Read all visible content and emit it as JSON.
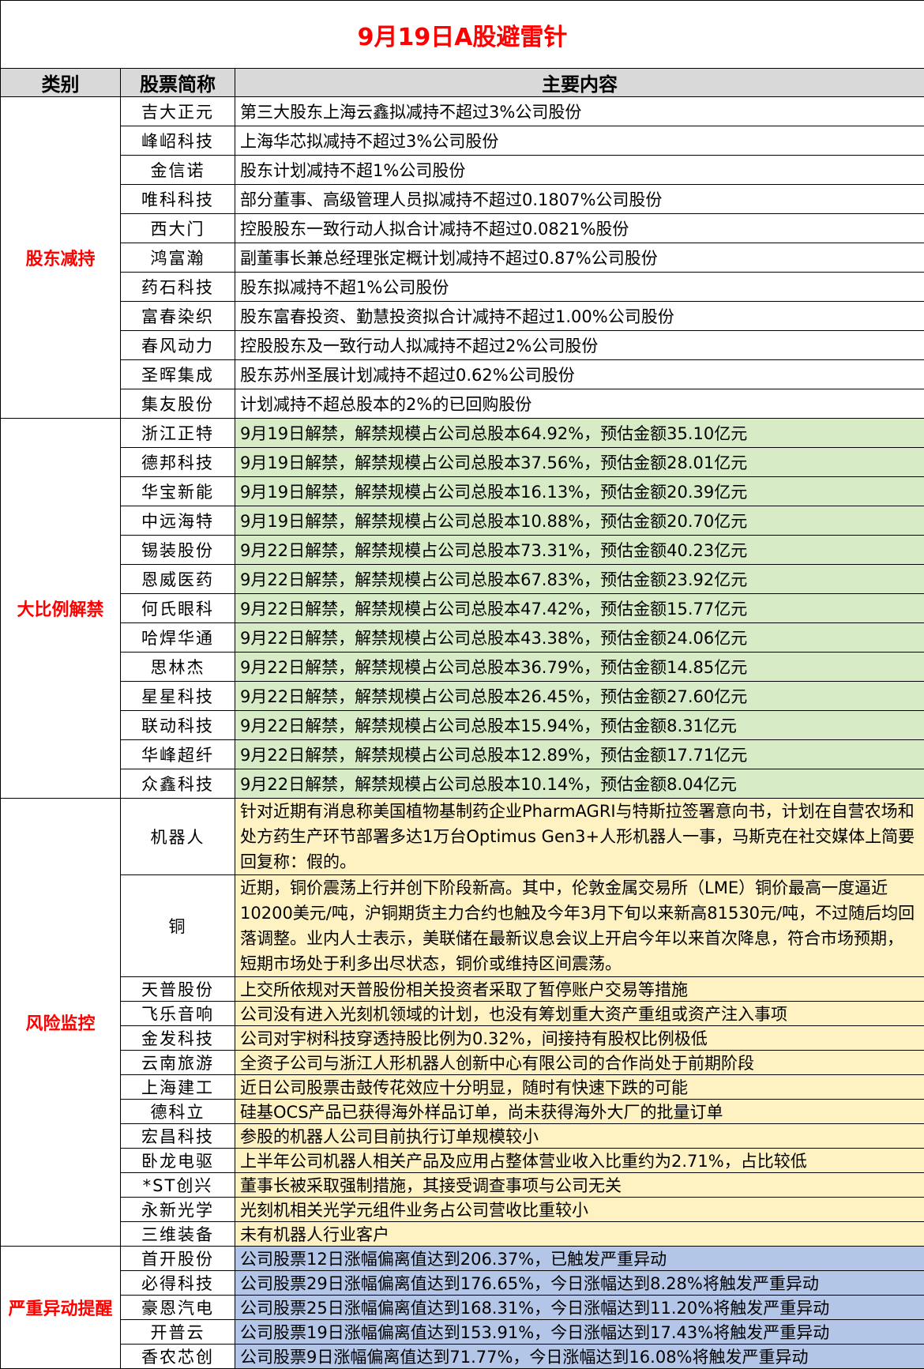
{
  "title": "9月19日A股避雷针",
  "headers": {
    "category": "类别",
    "stock": "股票简称",
    "content": "主要内容"
  },
  "sections": [
    {
      "category": "股东减持",
      "rows": [
        {
          "stock": "吉大正元",
          "content": "第三大股东上海云鑫拟减持不超过3%公司股份"
        },
        {
          "stock": "峰岹科技",
          "content": "上海华芯拟减持不超过3%公司股份"
        },
        {
          "stock": "金信诺",
          "content": "股东计划减持不超1%公司股份"
        },
        {
          "stock": "唯科科技",
          "content": "部分董事、高级管理人员拟减持不超过0.1807%公司股份"
        },
        {
          "stock": "西大门",
          "content": "控股股东一致行动人拟合计减持不超过0.0821%股份"
        },
        {
          "stock": "鸿富瀚",
          "content": "副董事长兼总经理张定概计划减持不超过0.87%公司股份"
        },
        {
          "stock": "药石科技",
          "content": "股东拟减持不超1%公司股份"
        },
        {
          "stock": "富春染织",
          "content": "股东富春投资、勤慧投资拟合计减持不超过1.00%公司股份"
        },
        {
          "stock": "春风动力",
          "content": "控股股东及一致行动人拟减持不超过2%公司股份"
        },
        {
          "stock": "圣晖集成",
          "content": "股东苏州圣展计划减持不超过0.62%公司股份"
        },
        {
          "stock": "集友股份",
          "content": "计划减持不超总股本的2%的已回购股份"
        }
      ]
    },
    {
      "category": "大比例解禁",
      "rows": [
        {
          "stock": "浙江正特",
          "content": "9月19日解禁，解禁规模占公司总股本64.92%，预估金额35.10亿元"
        },
        {
          "stock": "德邦科技",
          "content": "9月19日解禁，解禁规模占公司总股本37.56%，预估金额28.01亿元"
        },
        {
          "stock": "华宝新能",
          "content": "9月19日解禁，解禁规模占公司总股本16.13%，预估金额20.39亿元"
        },
        {
          "stock": "中远海特",
          "content": "9月19日解禁，解禁规模占公司总股本10.88%，预估金额20.70亿元"
        },
        {
          "stock": "锡装股份",
          "content": "9月22日解禁，解禁规模占公司总股本73.31%，预估金额40.23亿元"
        },
        {
          "stock": "恩威医药",
          "content": "9月22日解禁，解禁规模占公司总股本67.83%，预估金额23.92亿元"
        },
        {
          "stock": "何氏眼科",
          "content": "9月22日解禁，解禁规模占公司总股本47.42%，预估金额15.77亿元"
        },
        {
          "stock": "哈焊华通",
          "content": "9月22日解禁，解禁规模占公司总股本43.38%，预估金额24.06亿元"
        },
        {
          "stock": "思林杰",
          "content": "9月22日解禁，解禁规模占公司总股本36.79%，预估金额14.85亿元"
        },
        {
          "stock": "星星科技",
          "content": "9月22日解禁，解禁规模占公司总股本26.45%，预估金额27.60亿元"
        },
        {
          "stock": "联动科技",
          "content": "9月22日解禁，解禁规模占公司总股本15.94%，预估金额8.31亿元"
        },
        {
          "stock": "华峰超纤",
          "content": "9月22日解禁，解禁规模占公司总股本12.89%，预估金额17.71亿元"
        },
        {
          "stock": "众鑫科技",
          "content": "9月22日解禁，解禁规模占公司总股本10.14%，预估金额8.04亿元"
        }
      ]
    },
    {
      "category": "风险监控",
      "rows": [
        {
          "stock": "机器人",
          "content": "针对近期有消息称美国植物基制药企业PharmAGRI与特斯拉签署意向书，计划在自营农场和处方药生产环节部署多达1万台Optimus Gen3+人形机器人一事，马斯克在社交媒体上简要回复称：假的。"
        },
        {
          "stock": "铜",
          "content": "近期，铜价震荡上行并创下阶段新高。其中，伦敦金属交易所（LME）铜价最高一度逼近10200美元/吨，沪铜期货主力合约也触及今年3月下旬以来新高81530元/吨，不过随后均回落调整。业内人士表示，美联储在最新议息会议上开启今年以来首次降息，符合市场预期，短期市场处于利多出尽状态，铜价或维持区间震荡。"
        },
        {
          "stock": "天普股份",
          "content": "上交所依规对天普股份相关投资者采取了暂停账户交易等措施"
        },
        {
          "stock": "飞乐音响",
          "content": "公司没有进入光刻机领域的计划，也没有筹划重大资产重组或资产注入事项"
        },
        {
          "stock": "金发科技",
          "content": "公司对宇树科技穿透持股比例为0.32%，间接持有股权比例极低"
        },
        {
          "stock": "云南旅游",
          "content": "全资子公司与浙江人形机器人创新中心有限公司的合作尚处于前期阶段"
        },
        {
          "stock": "上海建工",
          "content": "近日公司股票击鼓传花效应十分明显，随时有快速下跌的可能"
        },
        {
          "stock": "德科立",
          "content": "硅基OCS产品已获得海外样品订单，尚未获得海外大厂的批量订单"
        },
        {
          "stock": "宏昌科技",
          "content": "参股的机器人公司目前执行订单规模较小"
        },
        {
          "stock": "卧龙电驱",
          "content": "上半年公司机器人相关产品及应用占整体营业收入比重约为2.71%，占比较低"
        },
        {
          "stock": "*ST创兴",
          "content": "董事长被采取强制措施，其接受调查事项与公司无关"
        },
        {
          "stock": "永新光学",
          "content": "光刻机相关光学元组件业务占公司营收比重较小"
        },
        {
          "stock": "三维装备",
          "content": "未有机器人行业客户"
        }
      ]
    },
    {
      "category": "严重异动提醒",
      "rows": [
        {
          "stock": "首开股份",
          "content": "公司股票12日涨幅偏离值达到206.37%，已触发严重异动"
        },
        {
          "stock": "必得科技",
          "content": "公司股票29日涨幅偏离值达到176.65%，今日涨幅达到8.28%将触发严重异动"
        },
        {
          "stock": "豪恩汽电",
          "content": "公司股票25日涨幅偏离值达到168.31%，今日涨幅达到11.20%将触发严重异动"
        },
        {
          "stock": "开普云",
          "content": "公司股票19日涨幅偏离值达到153.91%，今日涨幅达到17.43%将触发严重异动"
        },
        {
          "stock": "香农芯创",
          "content": "公司股票9日涨幅偏离值达到71.77%，今日涨幅达到16.08%将触发严重异动"
        }
      ]
    }
  ]
}
